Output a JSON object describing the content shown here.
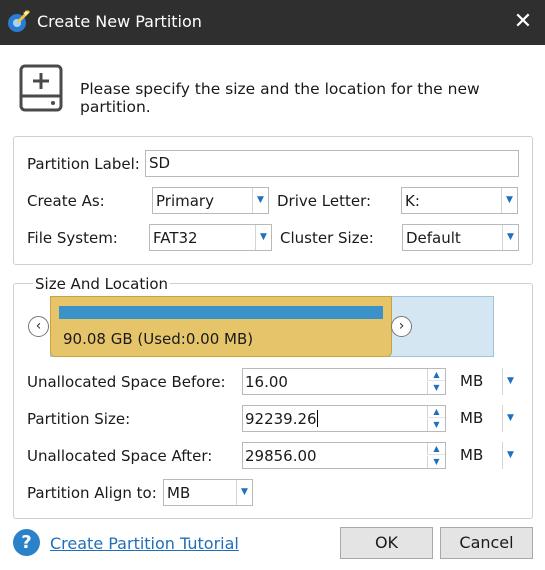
{
  "window": {
    "title": "Create New Partition",
    "close_glyph": "✕"
  },
  "header": {
    "instruction": "Please specify the size and the location for the new partition."
  },
  "partition_info": {
    "label_caption": "Partition Label:",
    "label_value": "SD",
    "create_as_caption": "Create As:",
    "create_as_value": "Primary",
    "drive_letter_caption": "Drive Letter:",
    "drive_letter_value": "K:",
    "file_system_caption": "File System:",
    "file_system_value": "FAT32",
    "cluster_size_caption": "Cluster Size:",
    "cluster_size_value": "Default"
  },
  "size_location": {
    "legend": "Size And Location",
    "partition_text": "90.08 GB (Used:0.00 MB)",
    "partition_fill": 0.77,
    "left_handle_glyph": "‹",
    "right_handle_glyph": "›",
    "unallocated_before_caption": "Unallocated Space Before:",
    "unallocated_before_value": "16.00",
    "unallocated_before_unit": "MB",
    "partition_size_caption": "Partition Size:",
    "partition_size_value": "92239.26",
    "partition_size_unit": "MB",
    "unallocated_after_caption": "Unallocated Space After:",
    "unallocated_after_value": "29856.00",
    "unallocated_after_unit": "MB",
    "align_caption": "Partition Align to:",
    "align_value": "MB"
  },
  "footer": {
    "help_glyph": "?",
    "tutorial_link": "Create Partition Tutorial",
    "ok_label": "OK",
    "cancel_label": "Cancel"
  },
  "colors": {
    "titlebar": "#2f2f2f",
    "partition": "#e6c56a",
    "partition_bar": "#3a92c9",
    "unallocated": "#d3e6f2",
    "link": "#1f6fb8",
    "accent": "#1e6fbf"
  },
  "icons": {
    "app": "wand-disk-icon",
    "header": "add-disk-icon",
    "close": "close-icon",
    "help": "help-circle-icon"
  }
}
